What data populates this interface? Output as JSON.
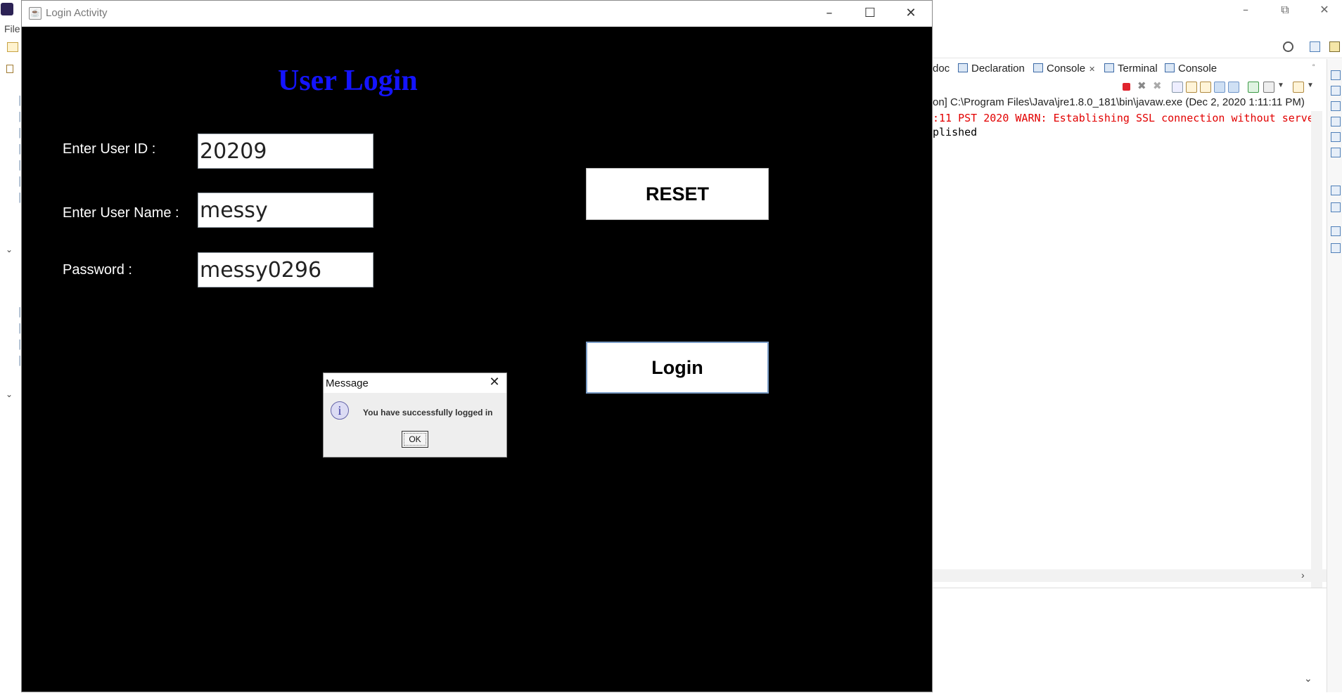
{
  "eclipse": {
    "menubar": {
      "file_label": "File"
    },
    "console_view": {
      "tabs": [
        {
          "label": "doc",
          "icon": "javadoc-icon"
        },
        {
          "label": "Declaration",
          "icon": "declaration-icon"
        },
        {
          "label": "Console",
          "icon": "console-icon",
          "active": true
        },
        {
          "label": "Terminal",
          "icon": "terminal-icon"
        },
        {
          "label": "Console",
          "icon": "console-icon"
        }
      ],
      "path_text": "on] C:\\Program Files\\Java\\jre1.8.0_181\\bin\\javaw.exe  (Dec 2, 2020 1:11:11 PM)",
      "lines": [
        ":11 PST 2020 WARN: Establishing SSL connection without serve",
        "plished"
      ],
      "colors": {
        "error": "#e20000",
        "normal": "#000000"
      }
    }
  },
  "login_window": {
    "title": "Login Activity",
    "heading": "User Login",
    "heading_color": "#1414ff",
    "background": "#000000",
    "fields": {
      "user_id": {
        "label": "Enter User ID :",
        "value": "20209"
      },
      "user_name": {
        "label": "Enter User Name :",
        "value": "messy"
      },
      "password": {
        "label": "Password :",
        "value": "messy0296"
      }
    },
    "buttons": {
      "reset": "RESET",
      "login": "Login"
    }
  },
  "message_dialog": {
    "title": "Message",
    "icon": "info-icon",
    "icon_glyph": "i",
    "text": "You have successfully logged in",
    "ok": "OK"
  }
}
